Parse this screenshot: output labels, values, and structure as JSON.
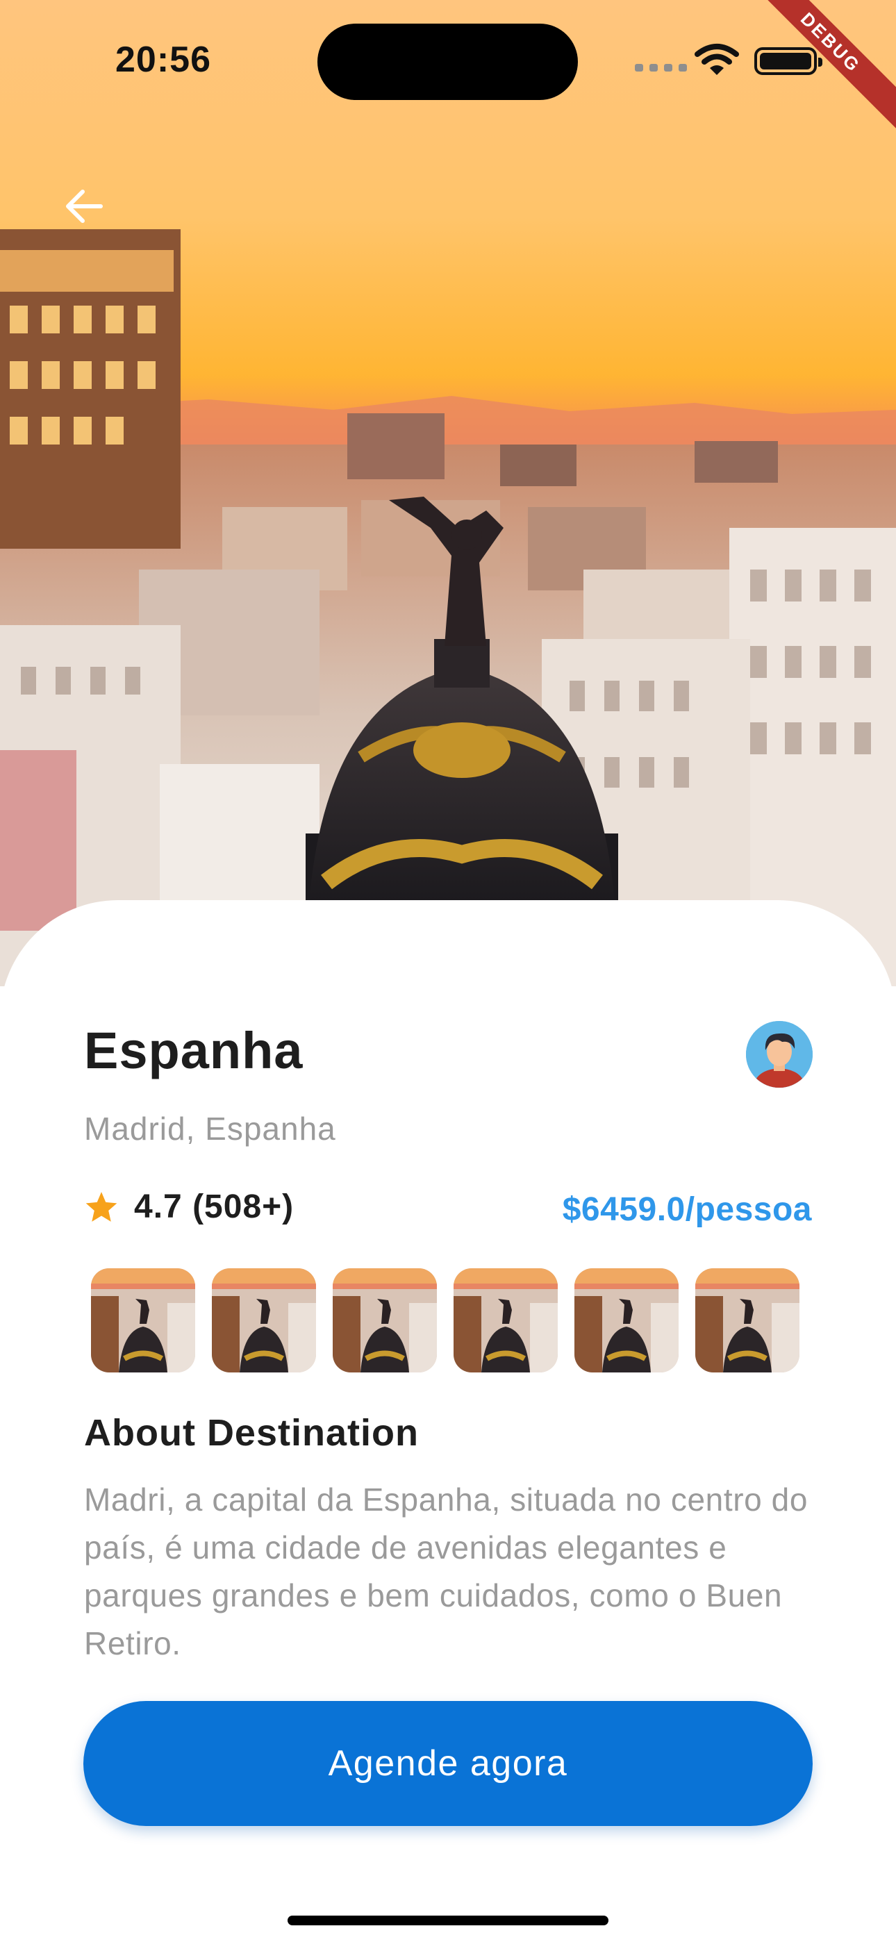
{
  "status_bar": {
    "time": "20:56"
  },
  "debug_banner": "DEBUG",
  "destination": {
    "name": "Espanha",
    "location": "Madrid, Espanha",
    "rating": "4.7 (508+)",
    "price": "$6459.0/pessoa"
  },
  "gallery": {
    "count": 6
  },
  "about": {
    "heading": "About Destination",
    "text": "Madri, a capital da Espanha, situada no centro do país, é uma cidade de avenidas elegantes e parques grandes e bem cuidados, como o Buen Retiro."
  },
  "cta": {
    "label": "Agende agora"
  },
  "colors": {
    "accent": "#0a73d6",
    "price": "#2f97ea",
    "star": "#f7a21b",
    "debug": "#b5312a"
  },
  "icons": {
    "back": "arrow-left-icon",
    "star": "star-icon",
    "avatar": "user-avatar-icon",
    "wifi": "wifi-icon",
    "battery": "battery-icon"
  }
}
